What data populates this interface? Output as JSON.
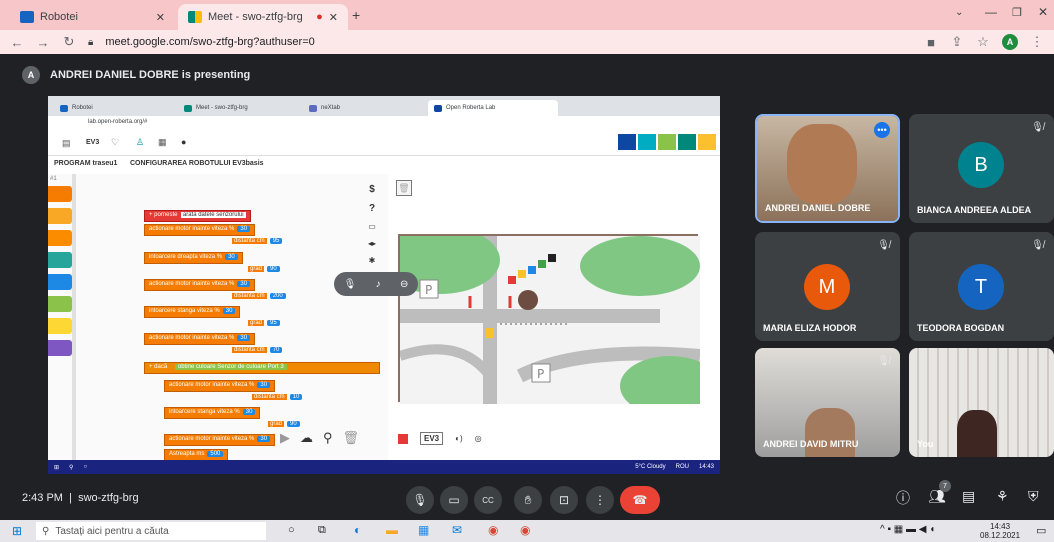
{
  "browser": {
    "tabs": [
      {
        "title": "Robotei",
        "active": false
      },
      {
        "title": "Meet - swo-ztfg-brg",
        "active": true
      }
    ],
    "url": "meet.google.com/swo-ztfg-brg?authuser=0",
    "profile_initial": "A"
  },
  "meet": {
    "presenter_initial": "A",
    "presenting_text": "ANDREI DANIEL DOBRE is presenting",
    "time": "2:43 PM",
    "meeting_code": "swo-ztfg-brg",
    "participant_count": "7",
    "tiles": [
      {
        "name": "ANDREI DANIEL DOBRE",
        "type": "video"
      },
      {
        "name": "BIANCA ANDREEA ALDEA",
        "type": "avatar",
        "initial": "B",
        "color": "#00838f"
      },
      {
        "name": "MARIA ELIZA HODOR",
        "type": "avatar",
        "initial": "M",
        "color": "#e8590c"
      },
      {
        "name": "TEODORA BOGDAN",
        "type": "avatar",
        "initial": "T",
        "color": "#1565c0"
      },
      {
        "name": "ANDREI DAVID MITRU",
        "type": "video"
      },
      {
        "name": "You",
        "type": "video"
      }
    ],
    "controls": [
      "mic-icon",
      "camera-icon",
      "captions-icon",
      "hand-icon",
      "present-icon",
      "more-icon",
      "end-call-icon"
    ]
  },
  "shared": {
    "tabs": [
      "Robotei",
      "Meet - swo-ztfg-brg",
      "neXtab",
      "Open Roberta Lab"
    ],
    "url": "lab.open-roberta.org/#",
    "robot": "EV3",
    "program_tab": "PROGRAM traseu1",
    "config_tab": "CONFIGURAREA ROBOTULUI EV3basis",
    "zoom_label": "#1",
    "blocks": {
      "start": "porneste",
      "show": "arata datele senzorului",
      "b1": "actionare motor",
      "b1dir": "inainte",
      "speed_label": "viteza %",
      "dist_label": "distanta cm",
      "grad_label": "grad",
      "turn_label": "intoarcere",
      "right": "dreapta",
      "left": "stanga",
      "v30": "30",
      "v95": "95",
      "v90": "90",
      "v200": "200",
      "v70": "70",
      "v10": "10",
      "v500": "500",
      "if_label": "dacă",
      "get_label": "obtine",
      "color_label": "culoare",
      "sensor_label": "Senzor de culoare",
      "port_label": "Port",
      "port_val": "3",
      "wait_label": "Astreapta ms"
    },
    "sim_labels": [
      "EV3"
    ],
    "weather": "5°C Cloudy",
    "inner_time": "14:43",
    "lang": "ROU"
  },
  "taskbar": {
    "search_placeholder": "Tastați aici pentru a căuta",
    "time": "14:43",
    "date": "08.12.2021"
  }
}
